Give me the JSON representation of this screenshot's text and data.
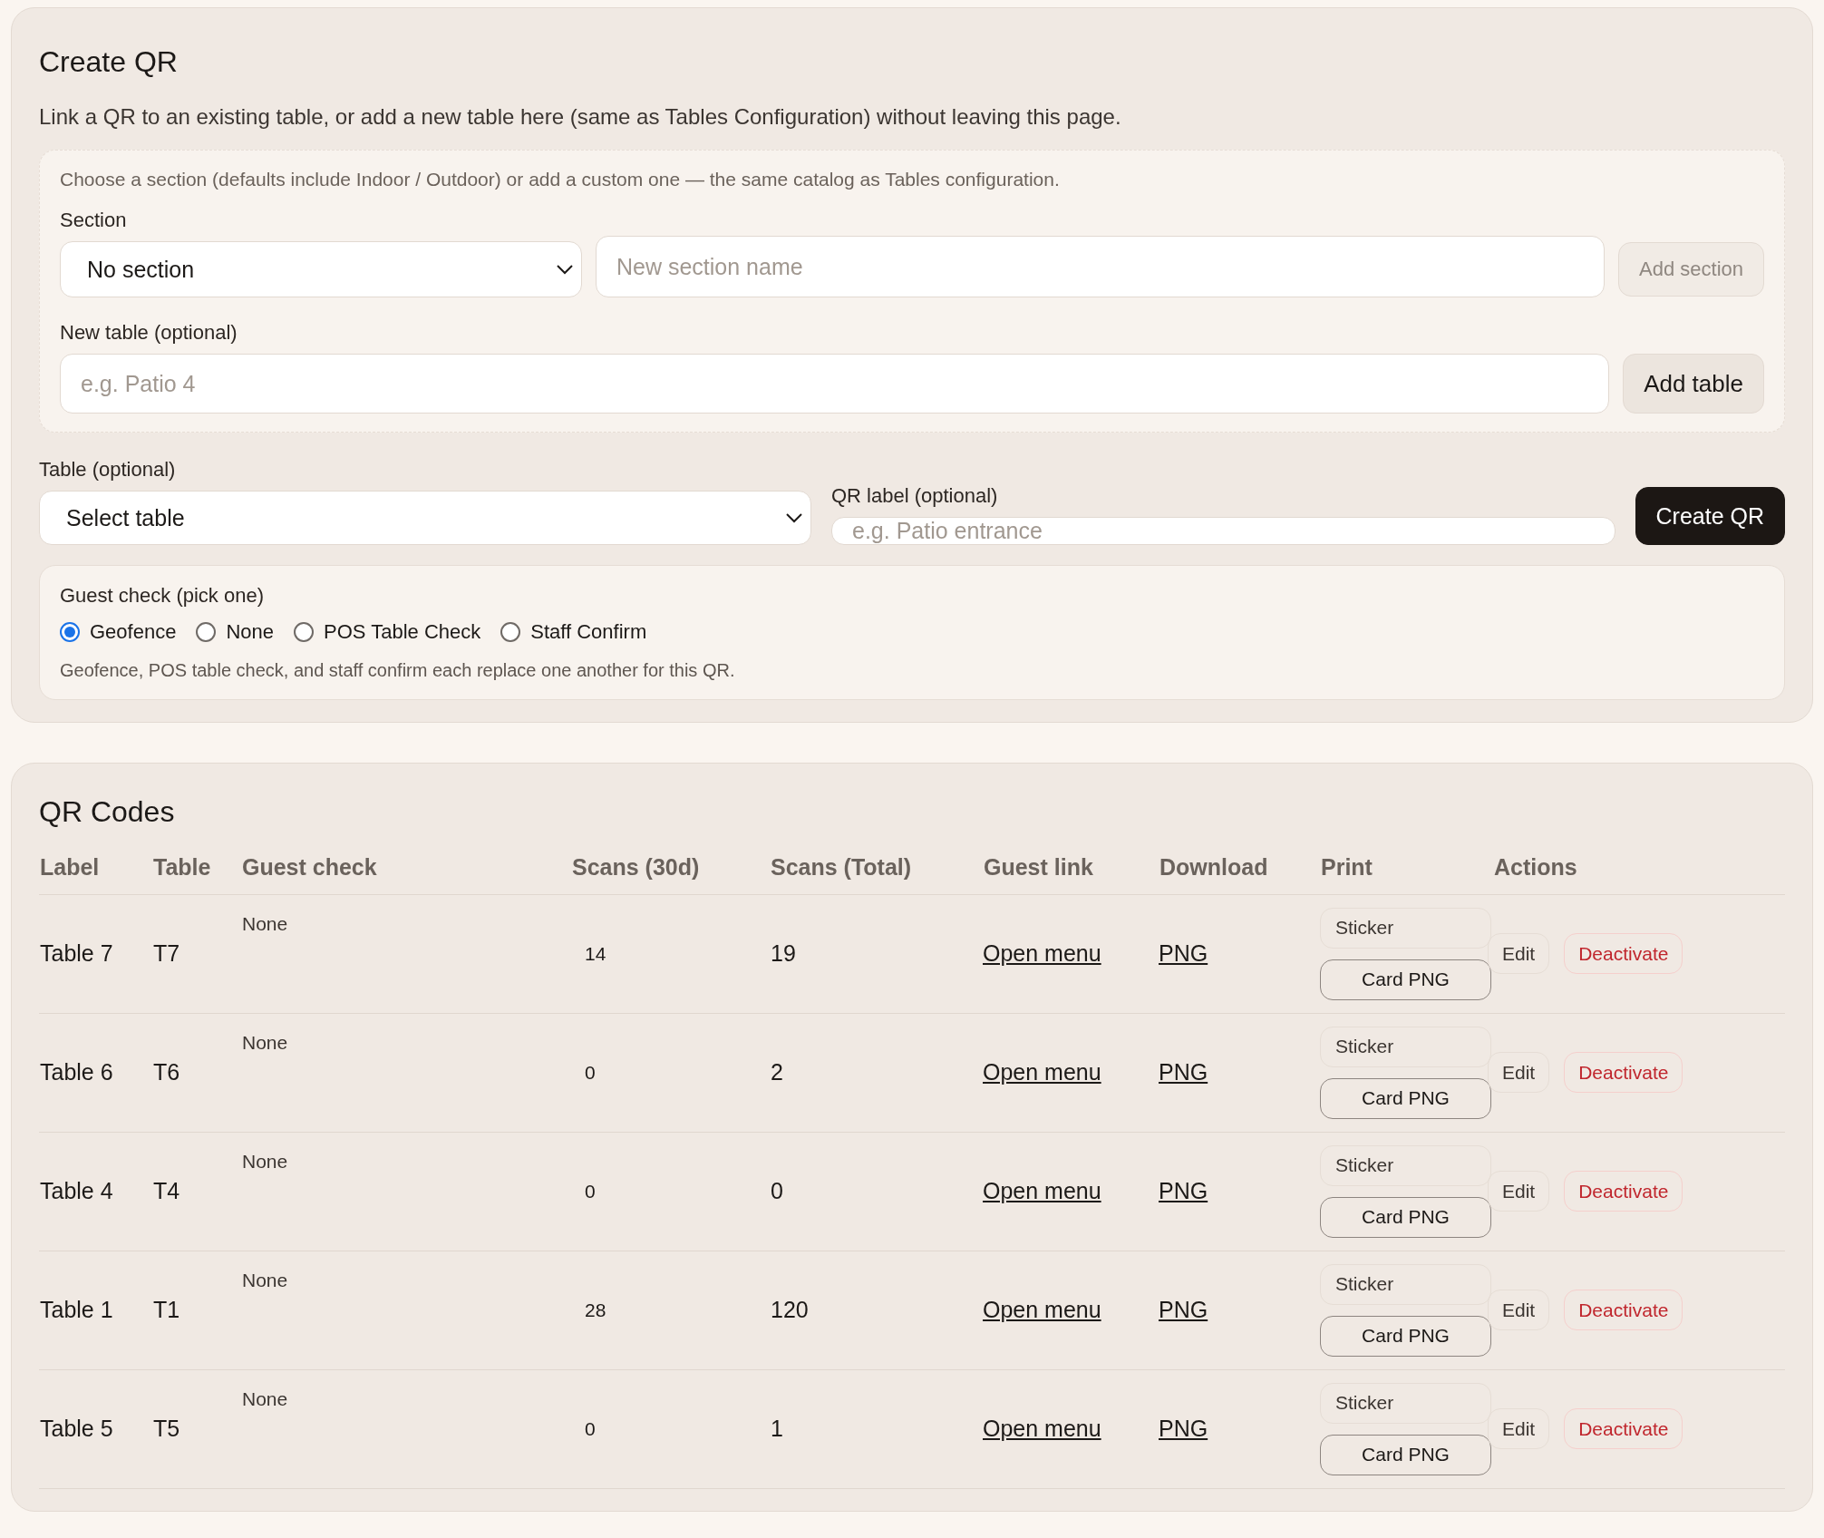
{
  "create_qr": {
    "title": "Create QR",
    "description": "Link a QR to an existing table, or add a new table here (same as Tables Configuration) without leaving this page.",
    "section_box": {
      "hint": "Choose a section (defaults include Indoor / Outdoor) or add a custom one — the same catalog as Tables configuration.",
      "section_label": "Section",
      "section_select": "No section",
      "new_section": {
        "placeholder": "New section name"
      },
      "add_section": {
        "label": "Add section",
        "disabled": true
      },
      "new_table_label": "New table (optional)",
      "new_table": {
        "placeholder": "e.g. Patio 4"
      },
      "add_table": {
        "label": "Add table",
        "disabled": false
      }
    },
    "table_label": "Table (optional)",
    "table_select": "Select table",
    "qr_label_label": "QR label (optional)",
    "qr_label": {
      "placeholder": "e.g. Patio entrance"
    },
    "create_button": "Create QR",
    "guest_check": {
      "label": "Guest check (pick one)",
      "options": [
        {
          "label": "Geofence",
          "selected": true
        },
        {
          "label": "None",
          "selected": false
        },
        {
          "label": "POS Table Check",
          "selected": false
        },
        {
          "label": "Staff Confirm",
          "selected": false
        }
      ],
      "note": "Geofence, POS table check, and staff confirm each replace one another for this QR."
    }
  },
  "qr_codes": {
    "title": "QR Codes",
    "columns": [
      "Label",
      "Table",
      "Guest check",
      "Scans (30d)",
      "Scans (Total)",
      "Guest link",
      "Download",
      "Print",
      "Actions"
    ],
    "rows": [
      {
        "label": "Table 7",
        "table": "T7",
        "guest_check": "None",
        "scans_30d": "14",
        "scans_total": "19",
        "guest_link": "Open menu",
        "download": "PNG",
        "print": [
          {
            "label": "Sticker",
            "disabled": true
          },
          {
            "label": "Card PNG",
            "disabled": false
          }
        ],
        "actions": [
          {
            "label": "Edit",
            "kind": "neutral"
          },
          {
            "label": "Deactivate",
            "kind": "danger"
          }
        ]
      },
      {
        "label": "Table 6",
        "table": "T6",
        "guest_check": "None",
        "scans_30d": "0",
        "scans_total": "2",
        "guest_link": "Open menu",
        "download": "PNG",
        "print": [
          {
            "label": "Sticker",
            "disabled": true
          },
          {
            "label": "Card PNG",
            "disabled": false
          }
        ],
        "actions": [
          {
            "label": "Edit",
            "kind": "neutral"
          },
          {
            "label": "Deactivate",
            "kind": "danger"
          }
        ]
      },
      {
        "label": "Table 4",
        "table": "T4",
        "guest_check": "None",
        "scans_30d": "0",
        "scans_total": "0",
        "guest_link": "Open menu",
        "download": "PNG",
        "print": [
          {
            "label": "Sticker",
            "disabled": true
          },
          {
            "label": "Card PNG",
            "disabled": false
          }
        ],
        "actions": [
          {
            "label": "Edit",
            "kind": "neutral"
          },
          {
            "label": "Deactivate",
            "kind": "danger"
          }
        ]
      },
      {
        "label": "Table 1",
        "table": "T1",
        "guest_check": "None",
        "scans_30d": "28",
        "scans_total": "120",
        "guest_link": "Open menu",
        "download": "PNG",
        "print": [
          {
            "label": "Sticker",
            "disabled": true
          },
          {
            "label": "Card PNG",
            "disabled": false
          }
        ],
        "actions": [
          {
            "label": "Edit",
            "kind": "neutral"
          },
          {
            "label": "Deactivate",
            "kind": "danger"
          }
        ]
      },
      {
        "label": "Table 5",
        "table": "T5",
        "guest_check": "None",
        "scans_30d": "0",
        "scans_total": "1",
        "guest_link": "Open menu",
        "download": "PNG",
        "print": [
          {
            "label": "Sticker",
            "disabled": true
          },
          {
            "label": "Card PNG",
            "disabled": false
          }
        ],
        "actions": [
          {
            "label": "Edit",
            "kind": "neutral"
          },
          {
            "label": "Deactivate",
            "kind": "danger"
          }
        ]
      }
    ]
  }
}
